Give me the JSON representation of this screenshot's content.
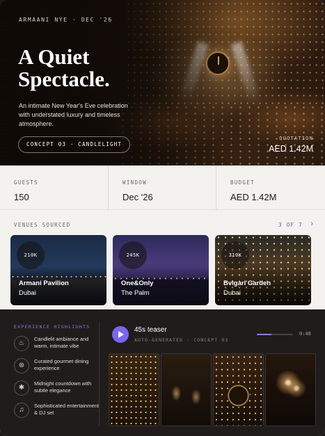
{
  "hero": {
    "eyebrow": "ARMAANI NYE · DEC '26",
    "title_line1": "A Quiet",
    "title_line2": "Spectacle.",
    "description": "An intimate New Year's Eve celebration with understated luxury and timeless atmosphere.",
    "concept_label": "CONCEPT 03 · CANDLELIGHT",
    "quotation_label": "QUOTATION",
    "quotation_value": "AED 1.42M"
  },
  "stats": [
    {
      "label": "GUESTS",
      "value": "150"
    },
    {
      "label": "WINDOW",
      "value": "Dec '26"
    },
    {
      "label": "BUDGET",
      "value": "AED 1.42M"
    }
  ],
  "venues": {
    "heading": "VENUES SOURCED",
    "page": "3 OF 7",
    "next_icon": "chevron-right-icon",
    "items": [
      {
        "capacity": "210K",
        "name": "Armani Pavilion",
        "city": "Dubai"
      },
      {
        "capacity": "245K",
        "name": "One&Only",
        "city": "The Palm"
      },
      {
        "capacity": "310K",
        "name": "Bvlgari Garden",
        "city": "Dubai"
      }
    ]
  },
  "highlights": {
    "heading": "EXPERIENCE HIGHLIGHTS",
    "items": [
      {
        "icon": "candle-icon",
        "glyph": "♨",
        "text": "Candlelit ambiance and warm, intimate vibe"
      },
      {
        "icon": "dish-icon",
        "glyph": "⊛",
        "text": "Curated gourmet dining experience"
      },
      {
        "icon": "sparkle-icon",
        "glyph": "✱",
        "text": "Midnight countdown with subtle elegance"
      },
      {
        "icon": "music-note-icon",
        "glyph": "♫",
        "text": "Sophisticated entertainment & DJ set"
      }
    ]
  },
  "teaser": {
    "title": "45s teaser",
    "subtitle": "AUTO-GENERATED · CONCEPT 03",
    "time": "0:48",
    "progress_fraction": 0.4
  },
  "colors": {
    "accent": "#7a66f0",
    "accent_text": "#5a4fcf",
    "dark_panel": "#1f1c1b"
  }
}
